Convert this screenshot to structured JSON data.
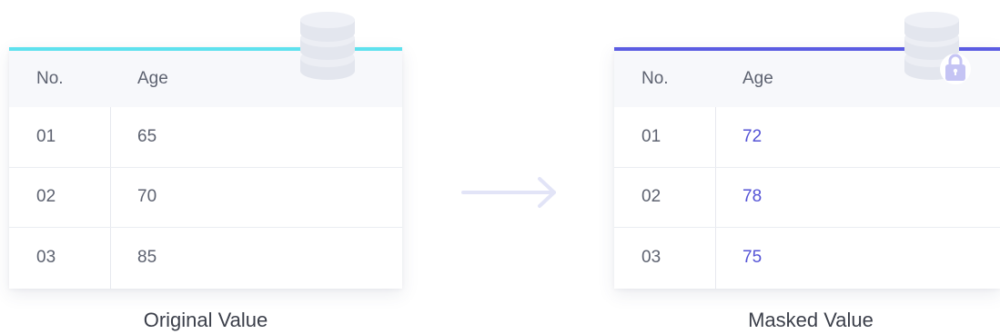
{
  "original": {
    "header": {
      "no": "No.",
      "age": "Age"
    },
    "rows": [
      {
        "no": "01",
        "age": "65"
      },
      {
        "no": "02",
        "age": "70"
      },
      {
        "no": "03",
        "age": "85"
      }
    ],
    "caption": "Original Value",
    "accent_color": "#5ee1ee",
    "icon": "database-icon"
  },
  "masked": {
    "header": {
      "no": "No.",
      "age": "Age"
    },
    "rows": [
      {
        "no": "01",
        "age": "72"
      },
      {
        "no": "02",
        "age": "78"
      },
      {
        "no": "03",
        "age": "75"
      }
    ],
    "caption": "Masked Value",
    "accent_color": "#5b5ce2",
    "value_color": "#5453d6",
    "icon": "locked-database-icon"
  },
  "arrow": {
    "icon": "arrow-right-icon"
  }
}
